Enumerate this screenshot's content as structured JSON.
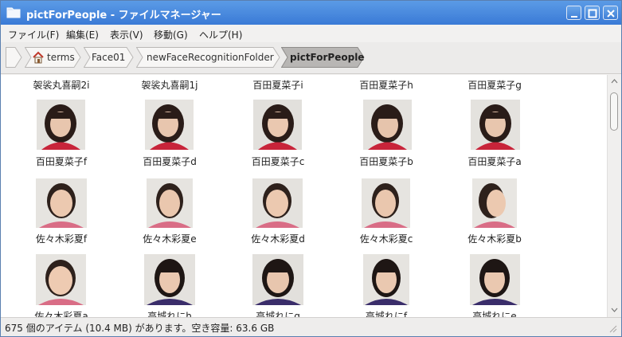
{
  "window": {
    "title": "pictForPeople - ファイルマネージャー"
  },
  "menu": {
    "items": [
      "ファイル(F)",
      "編集(E)",
      "表示(V)",
      "移動(G)",
      "ヘルプ(H)"
    ]
  },
  "breadcrumb": {
    "items": [
      "terms",
      "Face01",
      "newFaceRecognitionFolder",
      "pictForPeople"
    ]
  },
  "files": {
    "top_labels": [
      "袈裟丸喜嗣2i",
      "袈裟丸喜嗣1j",
      "百田夏菜子i",
      "百田夏菜子h",
      "百田夏菜子g"
    ],
    "row1_labels": [
      "百田夏菜子f",
      "百田夏菜子d",
      "百田夏菜子c",
      "百田夏菜子b",
      "百田夏菜子a"
    ],
    "row2_labels": [
      "佐々木彩夏f",
      "佐々木彩夏e",
      "佐々木彩夏d",
      "佐々木彩夏c",
      "佐々木彩夏b"
    ],
    "row3_labels": [
      "佐々木彩夏a",
      "高城れにh",
      "高城れにg",
      "高城れにf",
      "高城れにe"
    ]
  },
  "status": {
    "text": "675 個のアイテム (10.4 MB) があります。空き容量: 63.6 GB"
  },
  "colors": {
    "titlebar": "#4a8ade",
    "active_crumb": "#b8b6b4",
    "jacket_red": "#c8243a",
    "jacket_pink": "#d96d86",
    "jacket_purple": "#3a2d6a"
  }
}
